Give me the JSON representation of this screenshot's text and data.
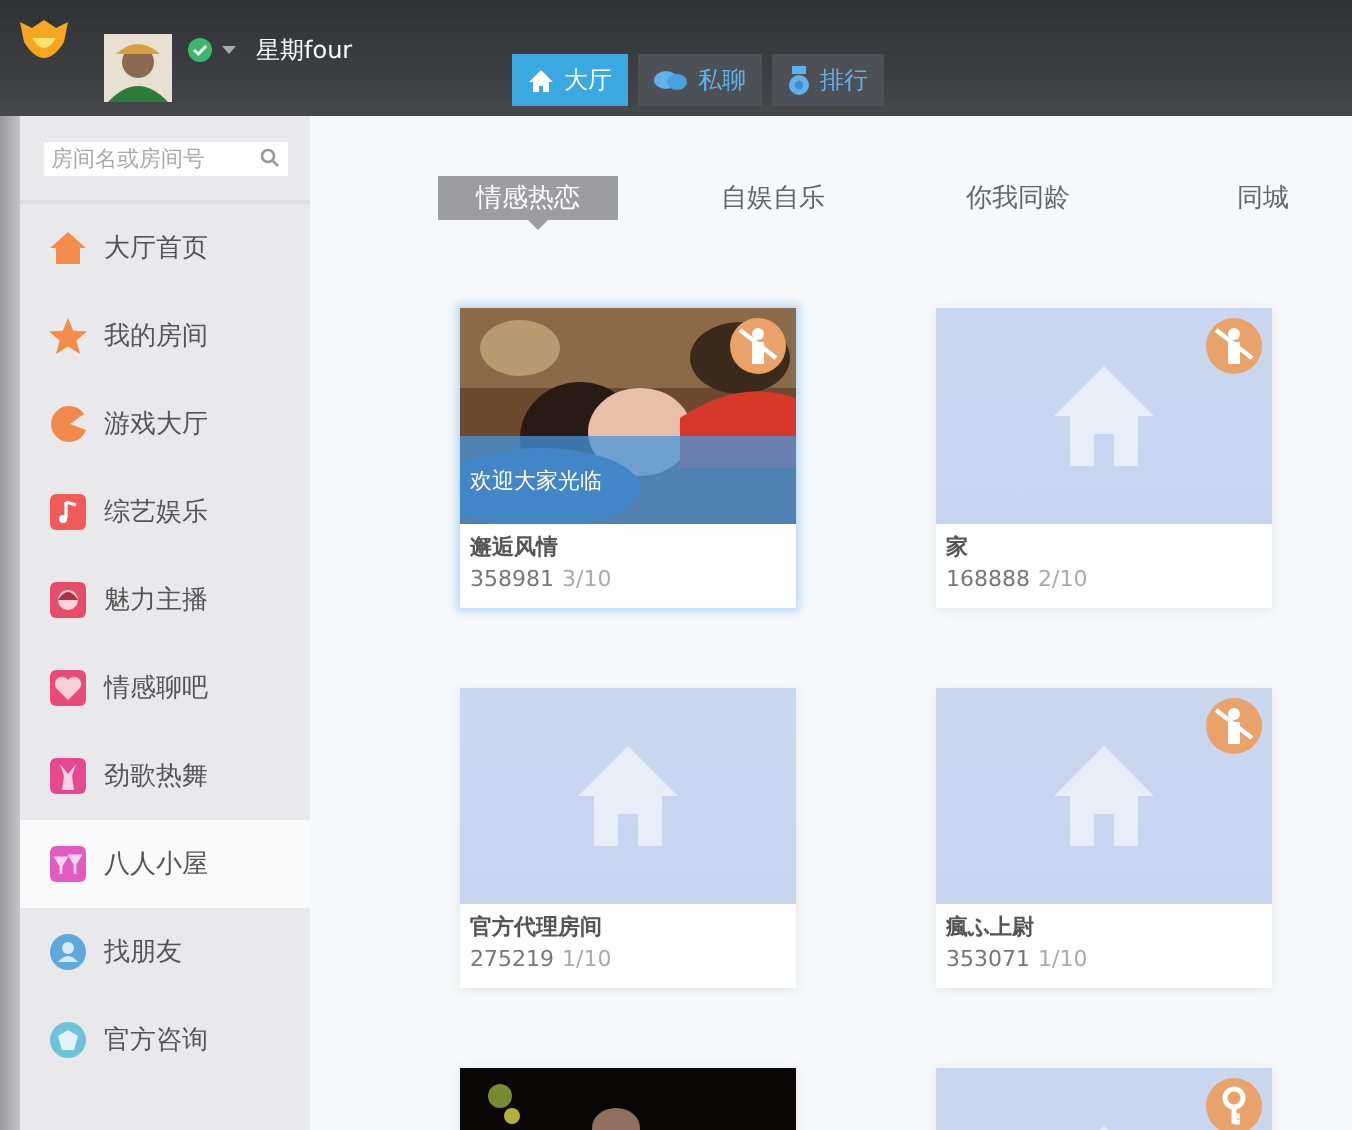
{
  "user": {
    "name": "星期four",
    "online": true
  },
  "nav_tabs": [
    {
      "label": "大厅",
      "selected": true
    },
    {
      "label": "私聊",
      "selected": false
    },
    {
      "label": "排行",
      "selected": false
    }
  ],
  "search": {
    "placeholder": "房间名或房间号"
  },
  "sidebar": {
    "items": [
      {
        "label": "大厅首页",
        "color": "#f58c4c",
        "selected": false
      },
      {
        "label": "我的房间",
        "color": "#f58c4c",
        "selected": false
      },
      {
        "label": "游戏大厅",
        "color": "#f08a4b",
        "selected": false
      },
      {
        "label": "综艺娱乐",
        "color": "#ef5a5a",
        "selected": false
      },
      {
        "label": "魅力主播",
        "color": "#e64d68",
        "selected": false
      },
      {
        "label": "情感聊吧",
        "color": "#e84a7c",
        "selected": false
      },
      {
        "label": "劲歌热舞",
        "color": "#e6498e",
        "selected": false
      },
      {
        "label": "八人小屋",
        "color": "#e25bc0",
        "selected": true
      },
      {
        "label": "找朋友",
        "color": "#5ea8dc",
        "selected": false
      },
      {
        "label": "官方咨询",
        "color": "#6ec3da",
        "selected": false
      }
    ]
  },
  "category_tabs": [
    {
      "label": "情感热恋",
      "selected": true
    },
    {
      "label": "自娱自乐",
      "selected": false
    },
    {
      "label": "你我同龄",
      "selected": false
    },
    {
      "label": "同城",
      "selected": false
    }
  ],
  "rooms": [
    {
      "kind": "picture",
      "caption": "欢迎大家光临",
      "name": "邂逅风情",
      "id": "358981",
      "occupancy": "3/10",
      "no_children": true,
      "selected": true
    },
    {
      "kind": "placeholder",
      "name": "家",
      "id": "168888",
      "occupancy": "2/10",
      "no_children": true,
      "selected": false
    },
    {
      "kind": "placeholder",
      "name": "官方代理房间",
      "id": "275219",
      "occupancy": "1/10",
      "selected": false
    },
    {
      "kind": "placeholder",
      "name": "瘋ふ上尉",
      "id": "353071",
      "occupancy": "1/10",
      "no_children": true,
      "selected": false
    },
    {
      "kind": "picture"
    },
    {
      "kind": "placeholder",
      "locked": true
    }
  ]
}
